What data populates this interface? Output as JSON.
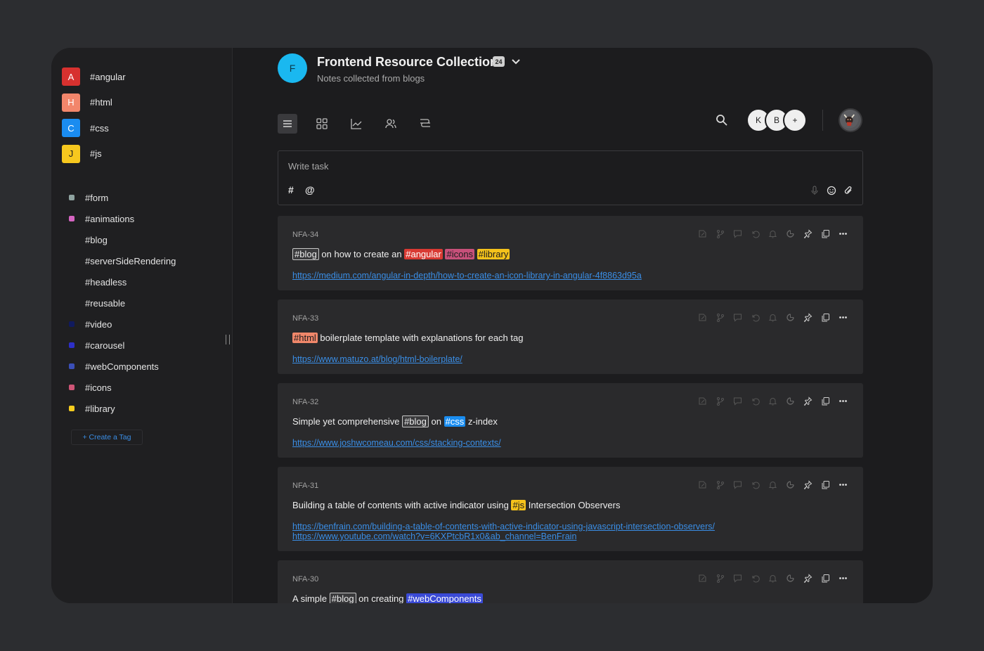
{
  "sidebar": {
    "projects": [
      {
        "initial": "A",
        "label": "#angular",
        "color": "#d7312f"
      },
      {
        "initial": "H",
        "label": "#html",
        "color": "#f2866b"
      },
      {
        "initial": "C",
        "label": "#css",
        "color": "#1a8cf0"
      },
      {
        "initial": "J",
        "label": "#js",
        "color": "#f7c81e"
      }
    ],
    "tags": [
      {
        "label": "#form",
        "color": "#8fa3a0"
      },
      {
        "label": "#animations",
        "color": "#d564c1"
      },
      {
        "label": "#blog",
        "color": ""
      },
      {
        "label": "#serverSideRendering",
        "color": ""
      },
      {
        "label": "#headless",
        "color": ""
      },
      {
        "label": "#reusable",
        "color": ""
      },
      {
        "label": "#video",
        "color": "#101a5e"
      },
      {
        "label": "#carousel",
        "color": "#2d2fc8"
      },
      {
        "label": "#webComponents",
        "color": "#3b4fb8"
      },
      {
        "label": "#icons",
        "color": "#cf5577"
      },
      {
        "label": "#library",
        "color": "#f7cd1e"
      }
    ],
    "create_tag_label": "+ Create a Tag"
  },
  "header": {
    "project_initial": "F",
    "title": "Frontend Resource Collection",
    "count": "24",
    "subtitle": "Notes collected from blogs"
  },
  "members": [
    "K",
    "B",
    "+"
  ],
  "composer": {
    "placeholder": "Write task",
    "hash": "#",
    "at": "@"
  },
  "tasks": [
    {
      "id": "NFA-34",
      "parts": [
        {
          "t": "#blog",
          "tag": "blog"
        },
        {
          "t": " on how to create an "
        },
        {
          "t": "#angular",
          "tag": "angular"
        },
        {
          "t": " "
        },
        {
          "t": "#icons",
          "tag": "icons"
        },
        {
          "t": " "
        },
        {
          "t": "#library",
          "tag": "library"
        }
      ],
      "links": [
        "https://medium.com/angular-in-depth/how-to-create-an-icon-library-in-angular-4f8863d95a"
      ]
    },
    {
      "id": "NFA-33",
      "parts": [
        {
          "t": "#html",
          "tag": "html"
        },
        {
          "t": " boilerplate template with explanations for each tag"
        }
      ],
      "links": [
        "https://www.matuzo.at/blog/html-boilerplate/"
      ]
    },
    {
      "id": "NFA-32",
      "parts": [
        {
          "t": "Simple yet comprehensive "
        },
        {
          "t": "#blog",
          "tag": "blog"
        },
        {
          "t": " on "
        },
        {
          "t": "#css",
          "tag": "css"
        },
        {
          "t": " z-index"
        }
      ],
      "links": [
        "https://www.joshwcomeau.com/css/stacking-contexts/"
      ]
    },
    {
      "id": "NFA-31",
      "parts": [
        {
          "t": "Building a table of contents with active indicator using "
        },
        {
          "t": "#js",
          "tag": "js"
        },
        {
          "t": " Intersection Observers"
        }
      ],
      "links": [
        "https://benfrain.com/building-a-table-of-contents-with-active-indicator-using-javascript-intersection-observers/",
        "https://www.youtube.com/watch?v=6KXPtcbR1x0&ab_channel=BenFrain"
      ]
    },
    {
      "id": "NFA-30",
      "parts": [
        {
          "t": "A simple "
        },
        {
          "t": "#blog",
          "tag": "blog"
        },
        {
          "t": " on creating "
        },
        {
          "t": "#webComponents",
          "tag": "wc"
        }
      ],
      "links": []
    }
  ],
  "card_actions": [
    "edit-icon",
    "branch-icon",
    "comment-icon",
    "history-icon",
    "bell-icon",
    "progress-icon",
    "pin-icon",
    "copy-icon",
    "more-icon"
  ]
}
